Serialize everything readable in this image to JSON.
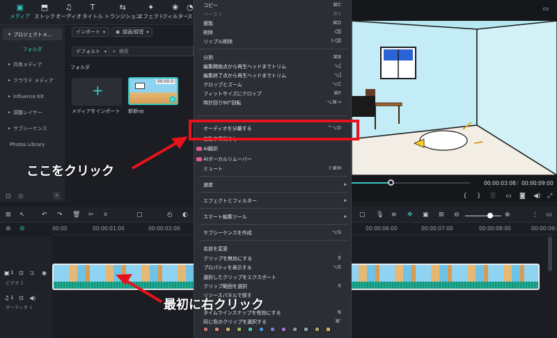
{
  "toolbar": {
    "tabs": [
      {
        "label": "メディア",
        "icon": "media-icon"
      },
      {
        "label": "ストック",
        "icon": "stock-icon"
      },
      {
        "label": "オーディオ",
        "icon": "music-icon"
      },
      {
        "label": "タイトル",
        "icon": "title-icon"
      },
      {
        "label": "トランジション",
        "icon": "transition-icon"
      },
      {
        "label": "エフェクト",
        "icon": "effect-icon"
      },
      {
        "label": "フィルター",
        "icon": "filter-icon"
      },
      {
        "label": "ス",
        "icon": "sticker-icon"
      }
    ]
  },
  "sidebar": {
    "items": [
      {
        "label": "プロジェクトメ..."
      },
      {
        "label": "フォルダ"
      },
      {
        "label": "共有メディア"
      },
      {
        "label": "クラウド メディア"
      },
      {
        "label": "Influence Kit"
      },
      {
        "label": "調整レイヤー"
      },
      {
        "label": "サブシーケンス"
      },
      {
        "label": "Photos Library"
      }
    ]
  },
  "media": {
    "import_label": "インポート",
    "record_label": "録画/録音",
    "sort_label": "デフォルト",
    "search_placeholder": "検索",
    "folder_label": "フォルダ",
    "import_card_label": "メディアをインポート",
    "clip_card_label": "新新op",
    "clip_duration": "00:00:0"
  },
  "preview": {
    "current_time": "00:00:03:08",
    "total_time": "00:00:09:00",
    "progress": 0.33,
    "separator": "/"
  },
  "timeline": {
    "ruler": [
      "00:00",
      "00:00:01:00",
      "00:00:02:00",
      "00:00:06:00",
      "00:00:07:00",
      "00:00:08:00",
      "00:00:09:00"
    ],
    "video_track_label": "ビデオ 1",
    "audio_track_label": "オーディオ 1",
    "video_track_num": "1",
    "audio_track_num": "1"
  },
  "context_menu": {
    "items": [
      {
        "label": "コピー",
        "shortcut": "⌘C"
      },
      {
        "label": "ペースト",
        "shortcut": "⌘V"
      },
      {
        "label": "複製",
        "shortcut": "⌘D"
      },
      {
        "label": "削除",
        "shortcut": "⌫"
      },
      {
        "label": "リップル削除",
        "shortcut": "⇧⌫"
      },
      {
        "label": "分割",
        "shortcut": "⌘B"
      },
      {
        "label": "編集開始点から再生ヘッドまでトリム",
        "shortcut": "⌥["
      },
      {
        "label": "編集終了点から再生ヘッドまでトリム",
        "shortcut": "⌥]"
      },
      {
        "label": "クロップとズーム",
        "shortcut": "⌥C"
      },
      {
        "label": "フィットサイズにクロップ",
        "shortcut": "⌘F"
      },
      {
        "label": "時計回り90°回転",
        "shortcut": "⌥⌘→"
      },
      {
        "label": "オーディオを分離する",
        "shortcut": "^⌥D"
      },
      {
        "label": "自動字幕起こし",
        "shortcut": ""
      },
      {
        "label": "AI翻訳",
        "shortcut": ""
      },
      {
        "label": "AIボーカルリムーバー",
        "shortcut": ""
      },
      {
        "label": "ミュート",
        "shortcut": "⇧⌘M"
      },
      {
        "label": "速度",
        "shortcut": ""
      },
      {
        "label": "エフェクトとフィルター",
        "shortcut": ""
      },
      {
        "label": "スマート編集ツール",
        "shortcut": ""
      },
      {
        "label": "サブシーケンスを作成",
        "shortcut": "⌥G"
      },
      {
        "label": "名前を変更",
        "shortcut": ""
      },
      {
        "label": "クリップを無効にする",
        "shortcut": "E"
      },
      {
        "label": "プロパティを表示する",
        "shortcut": "⌥E"
      },
      {
        "label": "選択したクリップをエクスポート",
        "shortcut": ""
      },
      {
        "label": "クリップ範囲を選択",
        "shortcut": "X"
      },
      {
        "label": "リソースパネルで探す",
        "shortcut": ""
      },
      {
        "label": "タイムラインスナップを有効にする",
        "shortcut": "N"
      },
      {
        "label": "同じ色のクリップを選択する",
        "shortcut": "⌘'"
      }
    ],
    "swatch_colors": [
      "#c9707a",
      "#d4866d",
      "#c9a46b",
      "#8fb56a",
      "#5bb9a6",
      "#4c8fd0",
      "#7f77cf",
      "#a46fc9",
      "#8b8f96",
      "#8aa0a6",
      "#a7a06a",
      "#c9b46b"
    ]
  },
  "annotations": {
    "click_here": "ここをクリック",
    "first_right_click": "最初に右クリック",
    "highlight_color": "#e8121d"
  },
  "colors": {
    "accent": "#3ac8c1",
    "highlight": "#e8121d"
  }
}
